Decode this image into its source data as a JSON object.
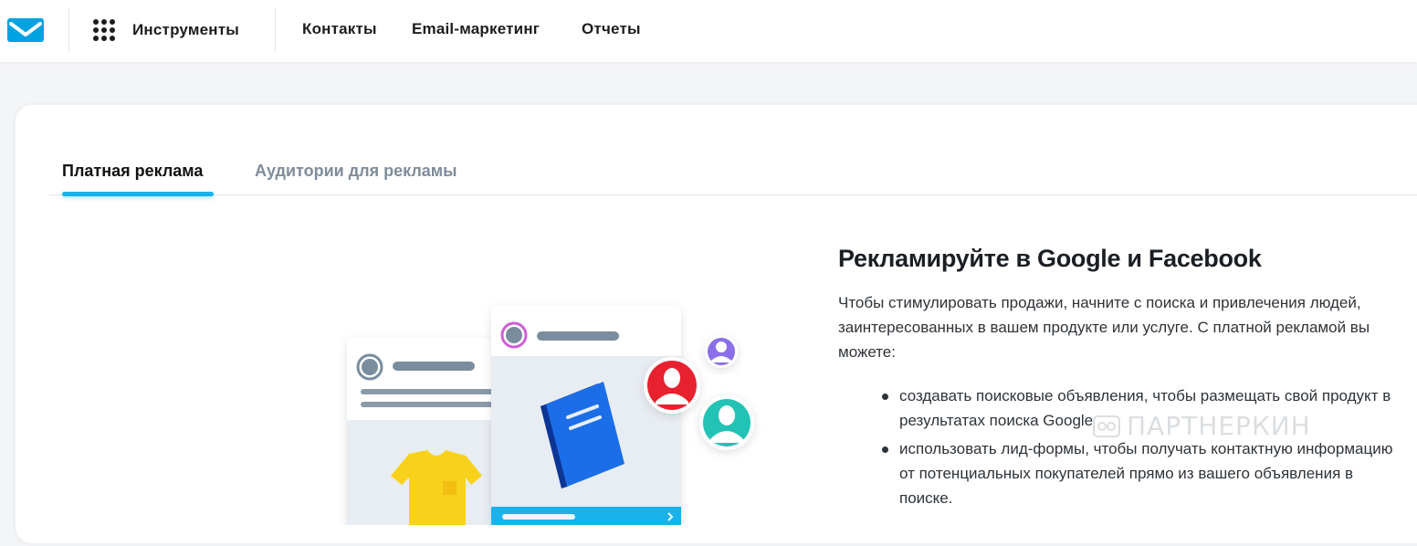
{
  "header": {
    "tools_label": "Инструменты",
    "nav": [
      "Контакты",
      "Email-маркетинг",
      "Отчеты"
    ]
  },
  "tabs": [
    {
      "label": "Платная реклама",
      "active": true
    },
    {
      "label": "Аудитории для рекламы",
      "active": false
    }
  ],
  "content": {
    "title": "Рекламируйте в Google и Facebook",
    "paragraph": "Чтобы стимулировать продажи, начните с поиска и привлечения людей, заинтересованных в вашем продукте или услуге. С платной рекламой вы можете:",
    "bullets": [
      "создавать поисковые объявления, чтобы размещать свой продукт в результатах поиска Google",
      "использовать лид-формы, чтобы получать контактную информацию от потенциальных покупателей прямо из вашего объявления в поиске."
    ]
  },
  "watermark": "ПАРТНЕРКИН",
  "colors": {
    "accent": "#19b2ea",
    "avatar_red": "#e8212f",
    "avatar_teal": "#22c3b4",
    "avatar_purple": "#8b6fe8",
    "book_blue": "#1b5fd9",
    "shirt_yellow": "#f8d11a"
  },
  "icons": [
    "envelope-logo-icon",
    "apps-grid-icon",
    "avatar-icon",
    "book-icon",
    "tshirt-icon",
    "chevron-right-icon"
  ]
}
